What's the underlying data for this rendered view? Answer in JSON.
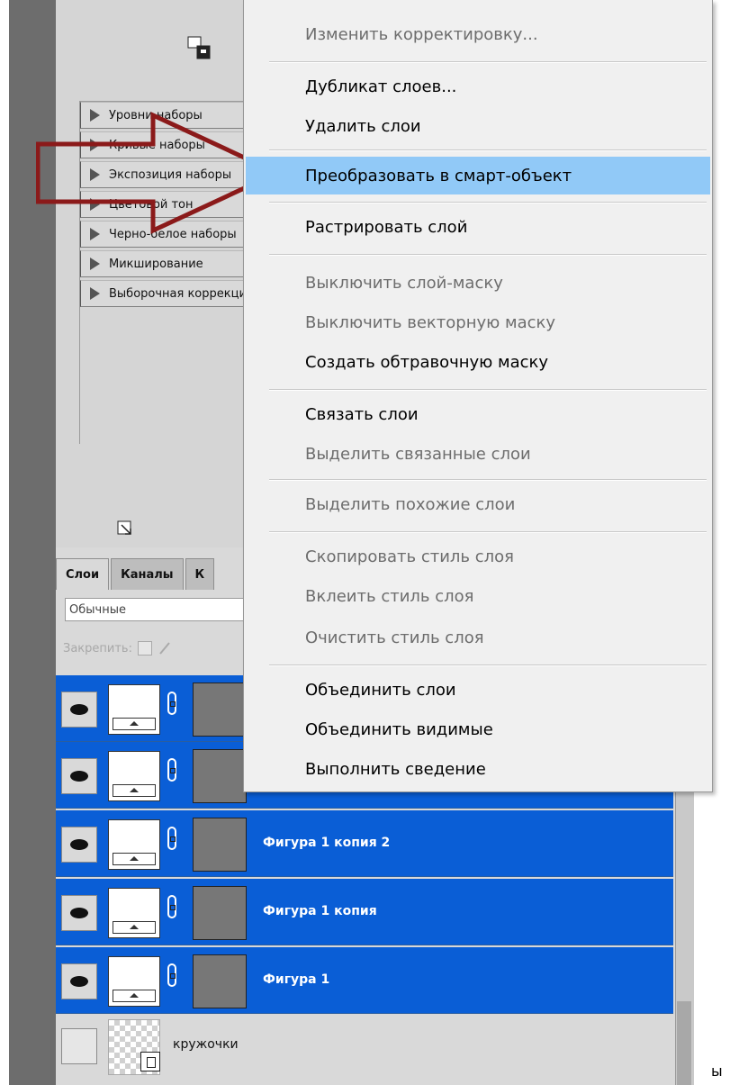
{
  "adjustments_panel": {
    "presets": [
      "Уровни наборы",
      "Кривые наборы",
      "Экспозиция наборы",
      "Цветовой тон",
      "Черно-белое наборы",
      "Микширование",
      "Выборочная коррекция"
    ]
  },
  "layers_panel": {
    "tabs": [
      "Слои",
      "Каналы",
      "К"
    ],
    "blend_mode": "Обычные",
    "lock_label": "Закрепить:",
    "layers": [
      {
        "name": ""
      },
      {
        "name": ""
      },
      {
        "name": "Фигура 1 копия 2"
      },
      {
        "name": "Фигура 1 копия"
      },
      {
        "name": "Фигура 1"
      },
      {
        "name": "кружочки"
      }
    ]
  },
  "context_menu": {
    "items": [
      {
        "label": "Изменить корректировку...",
        "disabled": true
      },
      {
        "label": "Дубликат слоев...",
        "disabled": false
      },
      {
        "label": "Удалить слои",
        "disabled": false
      },
      {
        "label": "Преобразовать в смарт-объект",
        "disabled": false,
        "highlighted": true
      },
      {
        "label": "Растрировать слой",
        "disabled": false
      },
      {
        "label": "Выключить слой-маску",
        "disabled": true
      },
      {
        "label": "Выключить векторную маску",
        "disabled": true
      },
      {
        "label": "Создать обтравочную маску",
        "disabled": false
      },
      {
        "label": "Связать слои",
        "disabled": false
      },
      {
        "label": "Выделить связанные слои",
        "disabled": true
      },
      {
        "label": "Выделить похожие слои",
        "disabled": true
      },
      {
        "label": "Скопировать стиль слоя",
        "disabled": true
      },
      {
        "label": "Вклеить стиль слоя",
        "disabled": true
      },
      {
        "label": "Очистить стиль слоя",
        "disabled": true
      },
      {
        "label": "Объединить слои",
        "disabled": false
      },
      {
        "label": "Объединить видимые",
        "disabled": false
      },
      {
        "label": "Выполнить сведение",
        "disabled": false
      }
    ]
  },
  "stray_text": "ы",
  "colors": {
    "menu_highlight": "#91c9f7",
    "selected_layer": "#0a5ed6",
    "arrow_outline": "#8b1a1a"
  }
}
